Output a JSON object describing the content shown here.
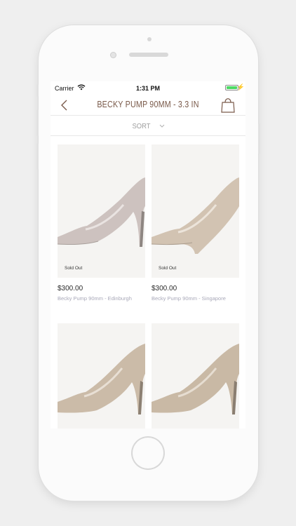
{
  "status_bar": {
    "carrier": "Carrier",
    "time": "1:31 PM",
    "battery_level": 1.0,
    "battery_color": "#4cd964"
  },
  "nav": {
    "back_icon": "chevron-left-icon",
    "title": "BECKY PUMP 90MM - 3.3 IN",
    "cart_icon": "shopping-bag-icon",
    "accent_color": "#7a5a4a"
  },
  "sort": {
    "label": "SORT",
    "icon": "chevron-down-icon"
  },
  "products": [
    {
      "price": "$300.00",
      "name": "Becky Pump 90mm - Edinburgh",
      "badge": "Sold Out",
      "shoe_color": "#cdc2bf"
    },
    {
      "price": "$300.00",
      "name": "Becky Pump 90mm - Singapore",
      "badge": "Sold Out",
      "shoe_color": "#d2c3b2"
    },
    {
      "shoe_color": "#cbbba8"
    },
    {
      "shoe_color": "#c9b9a5"
    }
  ]
}
